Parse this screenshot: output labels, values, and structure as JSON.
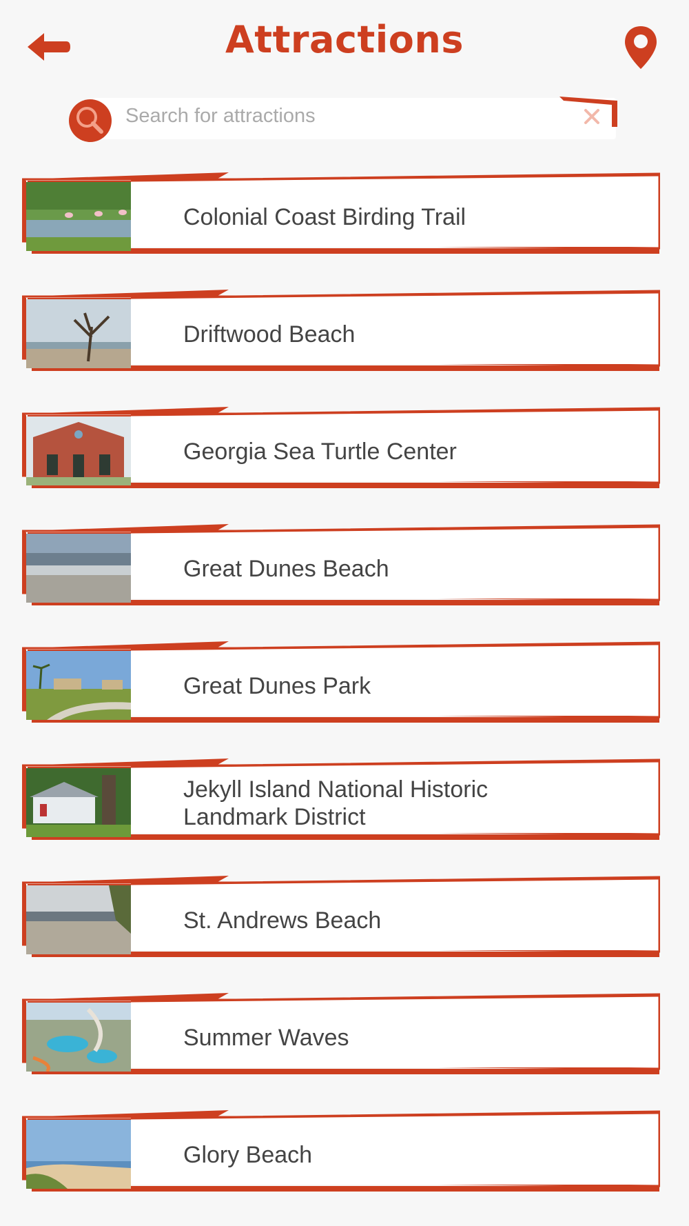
{
  "header": {
    "title": "Attractions",
    "back_icon": "arrow-left-icon",
    "map_icon": "map-pin-icon"
  },
  "search": {
    "placeholder": "Search for attractions",
    "value": "",
    "search_icon": "search-icon",
    "clear_icon": "close-icon"
  },
  "colors": {
    "accent": "#cd3f20",
    "background": "#f7f7f7",
    "card": "#ffffff",
    "text": "#444444"
  },
  "attractions": [
    {
      "label": "Colonial Coast Birding Trail",
      "thumbnail": "birds-in-marsh"
    },
    {
      "label": "Driftwood Beach",
      "thumbnail": "driftwood-tree-on-beach"
    },
    {
      "label": "Georgia Sea Turtle Center",
      "thumbnail": "brick-building"
    },
    {
      "label": "Great Dunes Beach",
      "thumbnail": "ocean-shore"
    },
    {
      "label": "Great Dunes Park",
      "thumbnail": "park-with-palms"
    },
    {
      "label": "Jekyll Island National Historic Landmark District",
      "thumbnail": "historic-house-with-oak"
    },
    {
      "label": "St. Andrews Beach",
      "thumbnail": "sandy-beach-with-trees"
    },
    {
      "label": "Summer Waves",
      "thumbnail": "water-park"
    },
    {
      "label": "Glory Beach",
      "thumbnail": "beach-path-to-ocean"
    }
  ]
}
